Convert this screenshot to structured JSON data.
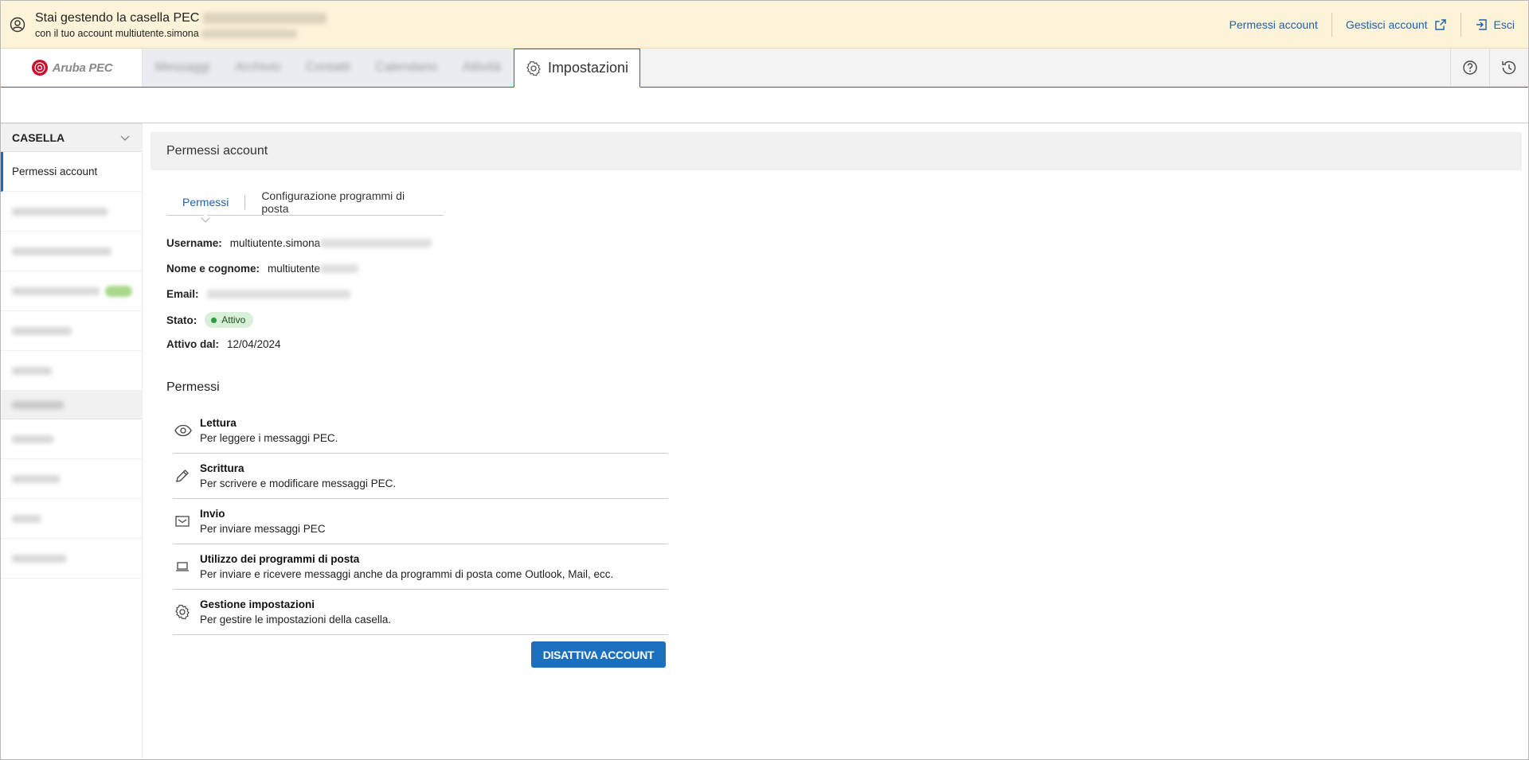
{
  "banner": {
    "line1": "Stai gestendo la casella PEC",
    "line2": "con il tuo account multiutente.simona",
    "actions": {
      "permessi": "Permessi account",
      "gestisci": "Gestisci account",
      "esci": "Esci"
    }
  },
  "nav": {
    "logo_text": "Aruba PEC",
    "tabs": [
      "Messaggi",
      "Archivio",
      "Contatti",
      "Calendario",
      "Attività"
    ],
    "active_tab": "Impostazioni"
  },
  "sidebar": {
    "section_title": "CASELLA",
    "active_item": "Permessi account"
  },
  "main": {
    "header": "Permessi account",
    "tabs": {
      "permessi": "Permessi",
      "config": "Configurazione programmi di posta"
    },
    "info": {
      "username_label": "Username:",
      "username_value": "multiutente.simona",
      "name_label": "Nome e cognome:",
      "name_value": "multiutente",
      "email_label": "Email:",
      "status_label": "Stato:",
      "status_value": "Attivo",
      "since_label": "Attivo dal:",
      "since_value": "12/04/2024"
    },
    "permissions_title": "Permessi",
    "permissions": [
      {
        "icon": "eye-icon",
        "title": "Lettura",
        "desc": "Per leggere i messaggi PEC."
      },
      {
        "icon": "pencil-icon",
        "title": "Scrittura",
        "desc": "Per scrivere e modificare messaggi PEC."
      },
      {
        "icon": "send-mail-icon",
        "title": "Invio",
        "desc": "Per inviare messaggi PEC"
      },
      {
        "icon": "laptop-icon",
        "title": "Utilizzo dei programmi di posta",
        "desc": "Per inviare e ricevere messaggi anche da programmi di posta come Outlook, Mail, ecc."
      },
      {
        "icon": "gear-icon",
        "title": "Gestione impostazioni",
        "desc": "Per gestire le impostazioni della casella."
      }
    ],
    "deactivate_button": "DISATTIVA ACCOUNT"
  },
  "colors": {
    "accent": "#1d67b5",
    "banner_bg": "#fcf3d9",
    "status_green": "#2a9d3a",
    "button": "#1a70bd"
  }
}
